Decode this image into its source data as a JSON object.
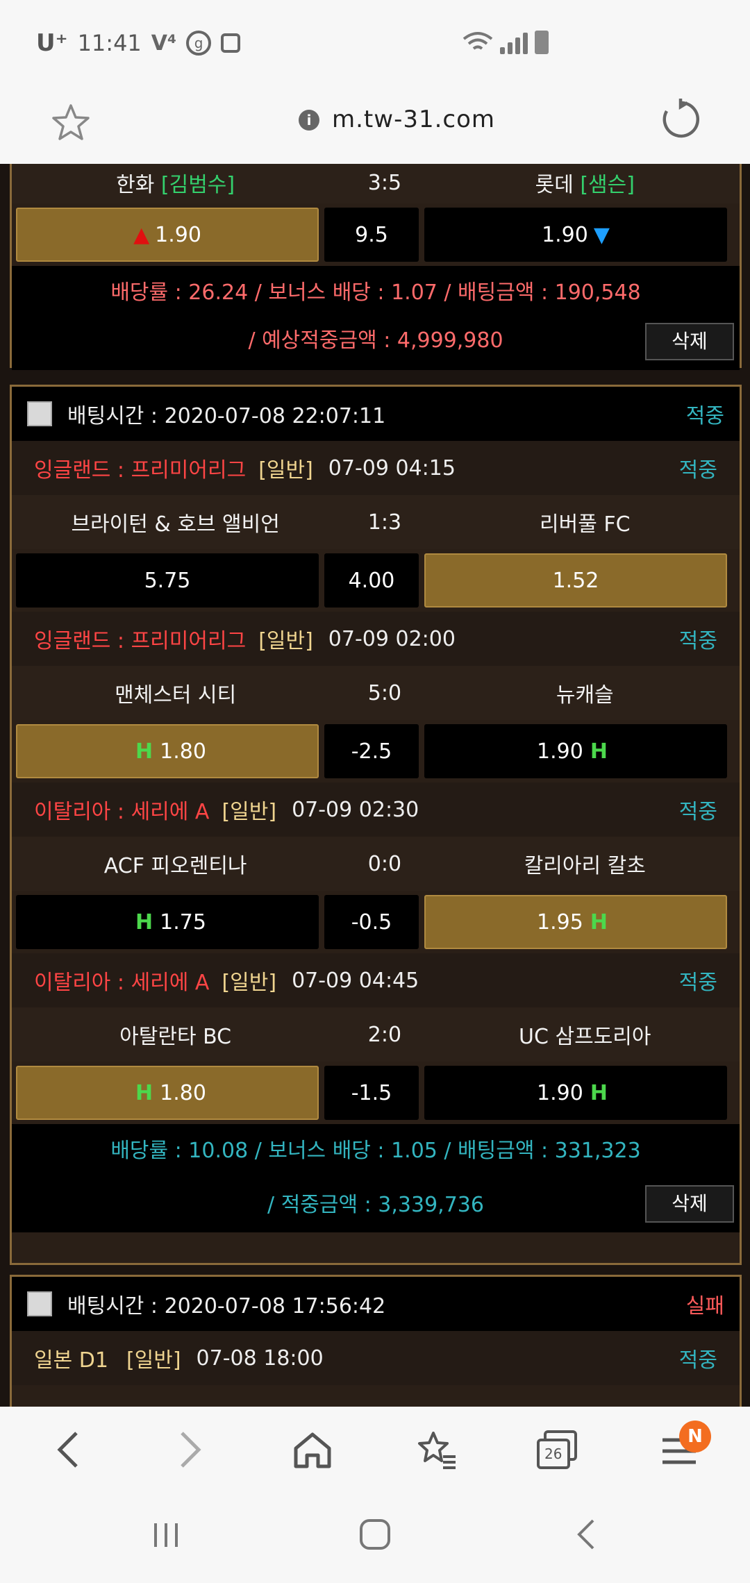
{
  "status_bar": {
    "carrier": "U⁺",
    "time": "11:41",
    "icons": [
      "volte-icon",
      "g-icon",
      "camera-icon"
    ],
    "right_icons": [
      "wifi-icon",
      "signal-icon",
      "battery-icon"
    ]
  },
  "browser": {
    "url": "m.tw-31.com",
    "tab_count": "26",
    "menu_badge": "N"
  },
  "colors": {
    "league_name": "#ff4545",
    "result_win": "#33b5c0",
    "result_fail": "#ff5a5a",
    "summary_fail": "#ff6b6b",
    "summary_win": "#33b5c0",
    "selected_bg": "#8a6a2a",
    "border": "#8a6a3a"
  },
  "card1": {
    "home": "한화",
    "home_bracket": "[김범수]",
    "score": "3:5",
    "away": "롯데",
    "away_bracket": "[샘슨]",
    "odds_home": "1.90",
    "odds_mid": "9.5",
    "odds_away": "1.90",
    "summary_line1": "배당률 : 26.24 / 보너스 배당 : 1.07 / 배팅금액 : 190,548",
    "summary_line2": "/ 예상적중금액 : 4,999,980",
    "delete_label": "삭제"
  },
  "card2": {
    "bet_time": "배팅시간 : 2020-07-08 22:07:11",
    "status": "적중",
    "games": [
      {
        "league": "잉글랜드 : 프리미어리그",
        "type": "[일반]",
        "time": "07-09 04:15",
        "result": "적중",
        "home": "브라이턴 & 호브 앨비언",
        "score": "1:3",
        "away": "리버풀 FC",
        "odds_home": "5.75",
        "odds_mid": "4.00",
        "odds_away": "1.52"
      },
      {
        "league": "잉글랜드 : 프리미어리그",
        "type": "[일반]",
        "time": "07-09 02:00",
        "result": "적중",
        "home": "맨체스터 시티",
        "score": "5:0",
        "away": "뉴캐슬",
        "odds_home": "1.80",
        "odds_mid": "-2.5",
        "odds_away": "1.90",
        "h_mark": "H"
      },
      {
        "league": "이탈리아 : 세리에 A",
        "type": "[일반]",
        "time": "07-09 02:30",
        "result": "적중",
        "home": "ACF 피오렌티나",
        "score": "0:0",
        "away": "칼리아리 칼초",
        "odds_home": "1.75",
        "odds_mid": "-0.5",
        "odds_away": "1.95",
        "h_mark": "H"
      },
      {
        "league": "이탈리아 : 세리에 A",
        "type": "[일반]",
        "time": "07-09 04:45",
        "result": "적중",
        "home": "아탈란타 BC",
        "score": "2:0",
        "away": "UC 삼프도리아",
        "odds_home": "1.80",
        "odds_mid": "-1.5",
        "odds_away": "1.90",
        "h_mark": "H"
      }
    ],
    "summary_line1": "배당률 : 10.08 / 보너스 배당 : 1.05 / 배팅금액 : 331,323",
    "summary_line2": "/ 적중금액 : 3,339,736",
    "delete_label": "삭제"
  },
  "card3": {
    "bet_time": "배팅시간 : 2020-07-08 17:56:42",
    "status": "실패",
    "league": "일본 D1",
    "type": "[일반]",
    "time": "07-08 18:00",
    "result": "적중"
  }
}
